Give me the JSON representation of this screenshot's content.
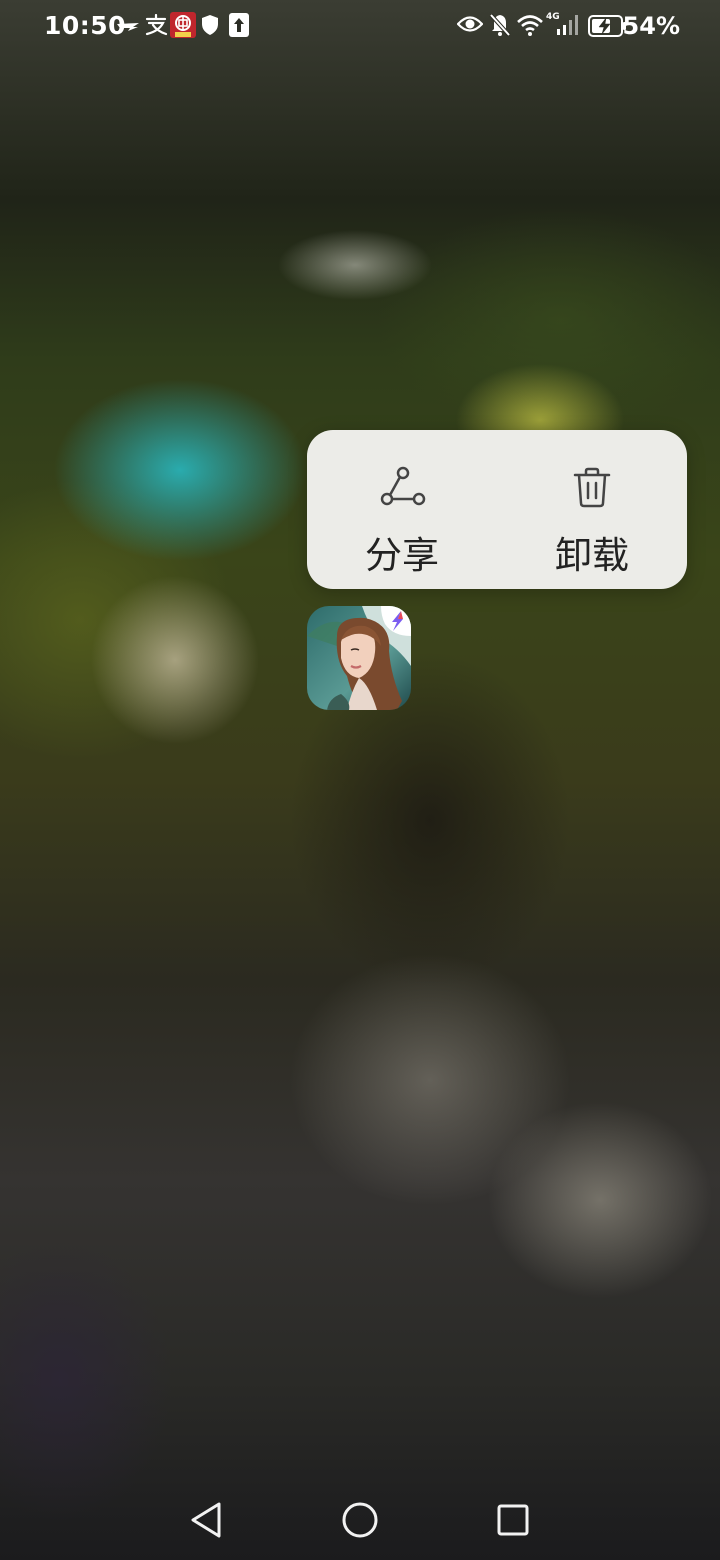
{
  "status_bar": {
    "time": "10:50",
    "battery_percent": "54%",
    "network_type": "4G",
    "left_icons": [
      "wing-icon",
      "alipay-icon",
      "bank-app-icon",
      "shield-icon",
      "upload-icon"
    ],
    "right_icons": [
      "eye-icon",
      "bell-muted-icon",
      "wifi-icon",
      "signal-icon",
      "battery-charging-icon"
    ]
  },
  "popup_menu": {
    "items": [
      {
        "label": "分享",
        "icon": "share-icon"
      },
      {
        "label": "卸载",
        "icon": "trash-icon"
      }
    ],
    "background": "#ecece8",
    "text_color": "#222222"
  },
  "selected_app": {
    "icon": "app-icon-woman-portrait",
    "badge_icon": "lightning-badge-icon",
    "badge_color": "#7b5cf0"
  },
  "nav_bar": {
    "buttons": [
      "back-icon",
      "home-icon",
      "recents-icon"
    ]
  }
}
